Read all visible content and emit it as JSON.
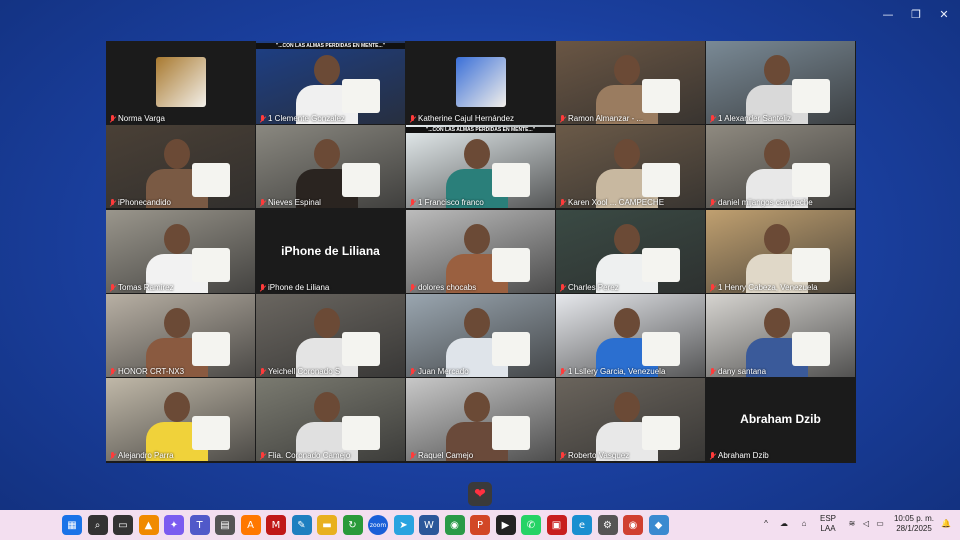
{
  "window_controls": {
    "minimize": "—",
    "restore": "❐",
    "close": "✕"
  },
  "participants": [
    {
      "name": "Norma Varga",
      "bg": "#1b1b1b",
      "accent": "#a8792f",
      "kind": "avatar"
    },
    {
      "name": "1 Clemente Gonzalez",
      "bg": "#1d3f86",
      "accent": "#f0f0f0",
      "kind": "video",
      "banner": "\"...CON LAS ALMAS PERDIDAS EN MENTE...\"",
      "highlight": "#33d17a"
    },
    {
      "name": "Katherine Cajul Hernández",
      "bg": "#1b1b1b",
      "accent": "#3a6fd8",
      "kind": "avatar"
    },
    {
      "name": "Ramon Almanzar - ...",
      "bg": "#6a5644",
      "accent": "#9a7c60",
      "kind": "video"
    },
    {
      "name": "1 Alexander Santeliz",
      "bg": "#7a8a96",
      "accent": "#d9d9d9",
      "kind": "video"
    },
    {
      "name": "iPhonecandido",
      "bg": "#4a4036",
      "accent": "#7a5a44",
      "kind": "video"
    },
    {
      "name": "Nieves Espinal",
      "bg": "#8a8880",
      "accent": "#2a2420",
      "kind": "video"
    },
    {
      "name": "1 Francisco franco",
      "bg": "#e7eef0",
      "accent": "#2a7f7a",
      "kind": "video",
      "banner": "\"...CON LAS ALMAS PERDIDAS EN MENTE...\"",
      "highlight": "#d22"
    },
    {
      "name": "Karen Xool ... CAMPECHE",
      "bg": "#6b5a48",
      "accent": "#c8b8a0",
      "kind": "video"
    },
    {
      "name": "daniel mijangos campeche",
      "bg": "#8f8a80",
      "accent": "#e8e8e8",
      "kind": "video"
    },
    {
      "name": "Tomas Ramirez",
      "bg": "#9a968c",
      "accent": "#f2f2f2",
      "kind": "video"
    },
    {
      "name": "iPhone de Liliana",
      "bg": "#1b1b1b",
      "accent": "#1b1b1b",
      "kind": "text"
    },
    {
      "name": "dolores chocabs",
      "bg": "#bcbcbc",
      "accent": "#9a6040",
      "kind": "video"
    },
    {
      "name": "Charles Perez",
      "bg": "#3a4a44",
      "accent": "#eef0f0",
      "kind": "video"
    },
    {
      "name": "1 Henry  Cabeza, Venezuela",
      "bg": "#c0a070",
      "accent": "#e0d8c8",
      "kind": "video"
    },
    {
      "name": "HONOR CRT-NX3",
      "bg": "#b8b0a4",
      "accent": "#8a5a40",
      "kind": "video"
    },
    {
      "name": "Yeichell Coronado S",
      "bg": "#6a6660",
      "accent": "#e4e4e4",
      "kind": "video"
    },
    {
      "name": "Juan Mercado",
      "bg": "#9aa6b0",
      "accent": "#dfe4ea",
      "kind": "video"
    },
    {
      "name": "1 Lsllery Garcia, Venezuela",
      "bg": "#e6e8ec",
      "accent": "#2b6fd0",
      "kind": "video"
    },
    {
      "name": "dany santana",
      "bg": "#d6d4d0",
      "accent": "#3a5a9a",
      "kind": "video"
    },
    {
      "name": "Alejandro Parra",
      "bg": "#c0b8a8",
      "accent": "#f0d23a",
      "kind": "video"
    },
    {
      "name": "Flia. Coronado Camejo",
      "bg": "#7a7a70",
      "accent": "#e0e0e0",
      "kind": "video"
    },
    {
      "name": "Raquel Camejo",
      "bg": "#c8c8c8",
      "accent": "#6a4a3a",
      "kind": "video"
    },
    {
      "name": "Roberto Vasquez",
      "bg": "#6a645c",
      "accent": "#e8e8e8",
      "kind": "video"
    },
    {
      "name": "Abraham Dzib",
      "bg": "#1b1b1b",
      "accent": "#1b1b1b",
      "kind": "text"
    }
  ],
  "reaction_button": "❤",
  "taskbar": {
    "apps": [
      {
        "icon": "windows-start-icon",
        "glyph": "▦",
        "color": "#1a73e8"
      },
      {
        "icon": "search-icon",
        "glyph": "⌕",
        "color": "#333333"
      },
      {
        "icon": "task-view-icon",
        "glyph": "▭",
        "color": "#333333"
      },
      {
        "icon": "vlc-icon",
        "glyph": "▲",
        "color": "#f08a00"
      },
      {
        "icon": "copilot-icon",
        "glyph": "✦",
        "color": "#7b5cf0"
      },
      {
        "icon": "teams-icon",
        "glyph": "T",
        "color": "#5059c9"
      },
      {
        "icon": "calculator-icon",
        "glyph": "▤",
        "color": "#555555"
      },
      {
        "icon": "avast-icon",
        "glyph": "A",
        "color": "#ff7800"
      },
      {
        "icon": "mcafee-icon",
        "glyph": "M",
        "color": "#c01818"
      },
      {
        "icon": "edit-app-icon",
        "glyph": "✎",
        "color": "#1e7fc0"
      },
      {
        "icon": "file-explorer-icon",
        "glyph": "▬",
        "color": "#e8b020"
      },
      {
        "icon": "refresh-app-icon",
        "glyph": "↻",
        "color": "#2a9a3a"
      },
      {
        "icon": "zoom-icon",
        "glyph": "zoom",
        "color": "#1a5fd8"
      },
      {
        "icon": "telegram-icon",
        "glyph": "➤",
        "color": "#2aa3e0"
      },
      {
        "icon": "word-icon",
        "glyph": "W",
        "color": "#2b579a"
      },
      {
        "icon": "chrome-icon",
        "glyph": "◉",
        "color": "#2a9a48"
      },
      {
        "icon": "powerpoint-icon",
        "glyph": "P",
        "color": "#d24726"
      },
      {
        "icon": "media-player-icon",
        "glyph": "▶",
        "color": "#222222"
      },
      {
        "icon": "whatsapp-icon",
        "glyph": "✆",
        "color": "#25d366"
      },
      {
        "icon": "pdf-icon",
        "glyph": "▣",
        "color": "#c81e1e"
      },
      {
        "icon": "edge-icon",
        "glyph": "e",
        "color": "#1a8fd0"
      },
      {
        "icon": "settings-icon",
        "glyph": "⚙",
        "color": "#555555"
      },
      {
        "icon": "chrome-alt-icon",
        "glyph": "◉",
        "color": "#d04030"
      },
      {
        "icon": "paint-icon",
        "glyph": "◆",
        "color": "#3a8ad0"
      }
    ],
    "tray": {
      "chevron": "^",
      "lang_top": "ESP",
      "lang_bottom": "LAA",
      "time": "10:05 p. m.",
      "date": "28/1/2025"
    }
  }
}
